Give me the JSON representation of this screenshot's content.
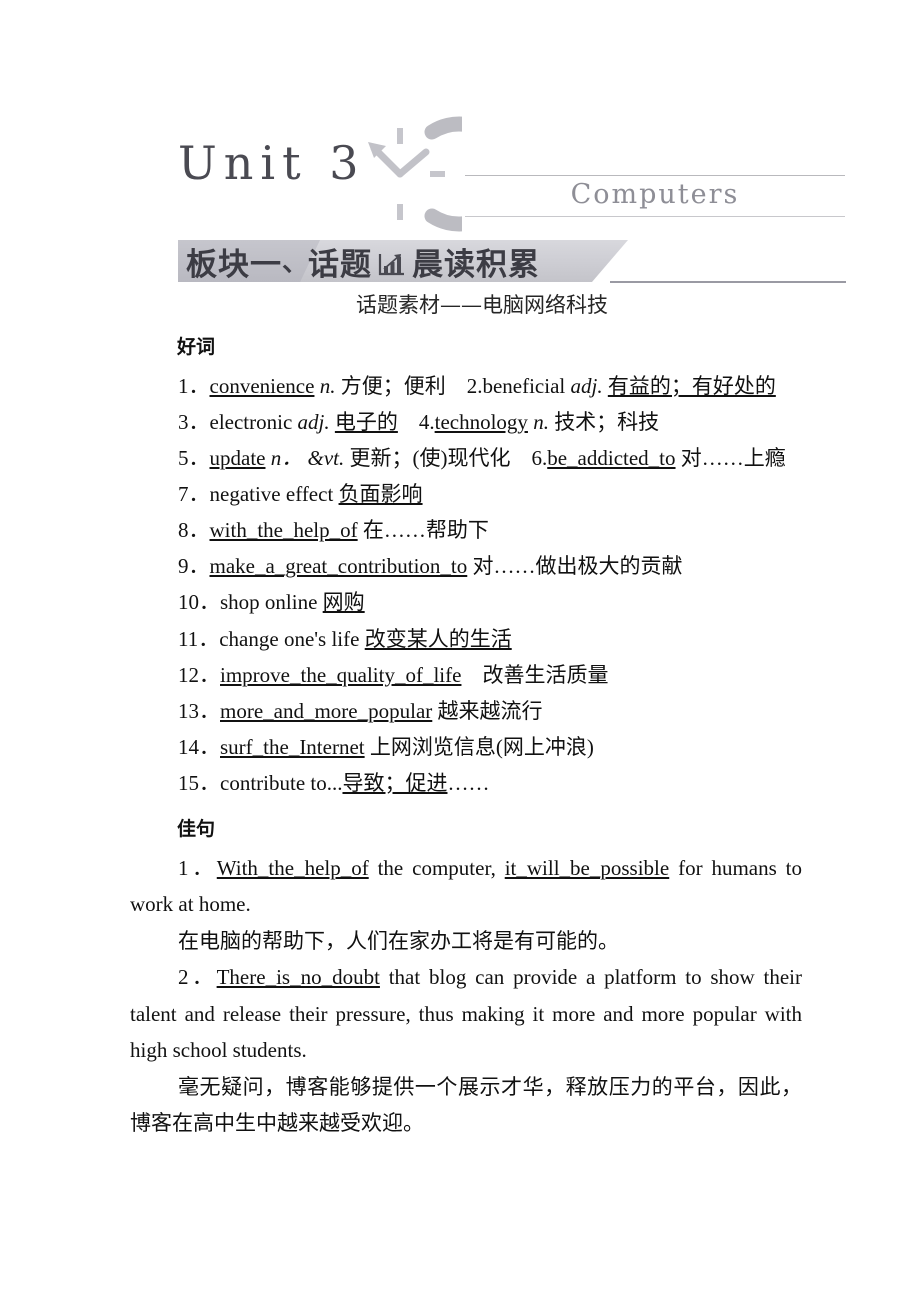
{
  "header": {
    "unit_title": "Unit 3",
    "topic_name": "Computers",
    "clock_icon": "clock-icon"
  },
  "banner": {
    "chip_label": "板块一",
    "separator": "、",
    "label_before_icon": "话题",
    "icon": "bar-chart-icon",
    "label_after_icon": "晨读积累"
  },
  "subtitle": "话题素材——电脑网络科技",
  "sections": {
    "words_heading": "好词",
    "sentences_heading": "佳句"
  },
  "words": [
    {
      "num": "1．",
      "parts": [
        {
          "t": "convenience",
          "u": true
        },
        {
          "t": " ",
          "u": false
        },
        {
          "t": "n.",
          "i": true
        },
        {
          "t": " 方便；便利　",
          "u": false
        },
        {
          "t": "2.beneficial ",
          "u": false
        },
        {
          "t": "adj.",
          "i": true
        },
        {
          "t": " ",
          "u": false
        },
        {
          "t": "有益的；有好处的",
          "u": true
        }
      ]
    },
    {
      "num": "3．",
      "parts": [
        {
          "t": "electronic ",
          "u": false
        },
        {
          "t": "adj.",
          "i": true
        },
        {
          "t": " ",
          "u": false
        },
        {
          "t": "电子的",
          "u": true
        },
        {
          "t": "　4.",
          "u": false
        },
        {
          "t": "technology",
          "u": true
        },
        {
          "t": " ",
          "u": false
        },
        {
          "t": "n.",
          "i": true
        },
        {
          "t": " 技术；科技",
          "u": false
        }
      ]
    },
    {
      "num": "5．",
      "parts": [
        {
          "t": "update",
          "u": true
        },
        {
          "t": " ",
          "u": false
        },
        {
          "t": "n．",
          "i": true
        },
        {
          "t": " ",
          "u": false
        },
        {
          "t": "&vt.",
          "i": true
        },
        {
          "t": " 更新；(使)现代化　",
          "u": false
        },
        {
          "t": "6.",
          "u": false
        },
        {
          "t": "be_addicted_to",
          "u": true
        },
        {
          "t": " 对……上瘾",
          "u": false
        }
      ]
    },
    {
      "num": "7．",
      "parts": [
        {
          "t": "negative effect ",
          "u": false
        },
        {
          "t": "负面影响",
          "u": true
        }
      ]
    },
    {
      "num": "8．",
      "parts": [
        {
          "t": "with_the_help_of",
          "u": true
        },
        {
          "t": " 在……帮助下",
          "u": false
        }
      ]
    },
    {
      "num": "9．",
      "parts": [
        {
          "t": "make_a_great_contribution_to",
          "u": true
        },
        {
          "t": " 对……做出极大的贡献",
          "u": false
        }
      ]
    },
    {
      "num": "10．",
      "parts": [
        {
          "t": "shop online ",
          "u": false
        },
        {
          "t": "网购",
          "u": true
        }
      ]
    },
    {
      "num": "11．",
      "parts": [
        {
          "t": "change one's life ",
          "u": false
        },
        {
          "t": "改变某人的生活",
          "u": true
        }
      ]
    },
    {
      "num": "12．",
      "parts": [
        {
          "t": "improve_the_quality_of_life",
          "u": true
        },
        {
          "t": "　改善生活质量",
          "u": false
        }
      ]
    },
    {
      "num": "13．",
      "parts": [
        {
          "t": "more_and_more_popular",
          "u": true
        },
        {
          "t": " 越来越流行",
          "u": false
        }
      ]
    },
    {
      "num": "14．",
      "parts": [
        {
          "t": "surf_the_Internet",
          "u": true
        },
        {
          "t": " 上网浏览信息(网上冲浪)",
          "u": false
        }
      ]
    },
    {
      "num": "15．",
      "parts": [
        {
          "t": "contribute to...",
          "u": false
        },
        {
          "t": "导致；促进",
          "u": true
        },
        {
          "t": "……",
          "u": false
        }
      ]
    }
  ],
  "sentences": [
    {
      "num": "1．",
      "parts": [
        {
          "t": "With_the_help_of",
          "u": true
        },
        {
          "t": " the computer, ",
          "u": false
        },
        {
          "t": "it_will_be_possible",
          "u": true
        },
        {
          "t": " for humans to work at home.",
          "u": false
        }
      ],
      "translation": "在电脑的帮助下，人们在家办工将是有可能的。"
    },
    {
      "num": "2．",
      "parts": [
        {
          "t": "There_is_no_doubt",
          "u": true
        },
        {
          "t": " that blog can provide a platform to show their talent and release their pressure, thus making it more and more popular with high school students.",
          "u": false
        }
      ],
      "translation": "毫无疑问，博客能够提供一个展示才华，释放压力的平台，因此，博客在高中生中越来越受欢迎。"
    }
  ],
  "colors": {
    "ink": "#111111",
    "unit_title": "#4a4a52",
    "topic_name": "#8e8e96",
    "banner_gray": "#cfcfd5",
    "banner_chip_gray": "#bdbdc5",
    "rule_gray": "#9a9aa3",
    "clock_gray": "#bcbcc2"
  }
}
